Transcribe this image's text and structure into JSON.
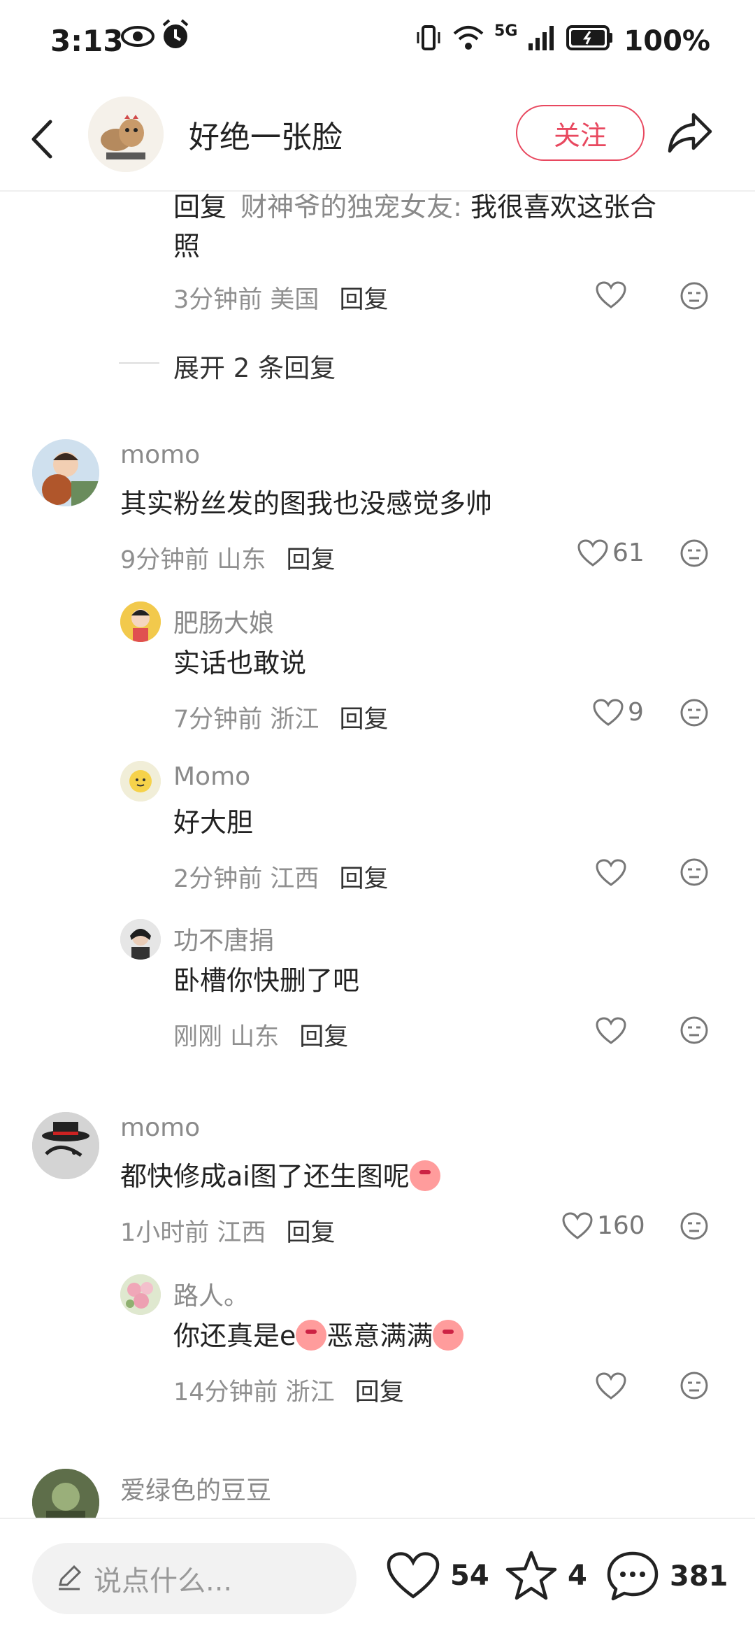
{
  "status_bar": {
    "time": "3:13",
    "network": "5G",
    "battery": "100%"
  },
  "header": {
    "username": "好绝一张脸",
    "follow_label": "关注"
  },
  "thread0": {
    "reply_prefix": "回复",
    "reply_to": "财神爷的独宠女友:",
    "text_line1": "我很喜欢这张合",
    "text_line2": "照",
    "meta": "3分钟前 美国",
    "reply_label": "回复",
    "expand_label": "展开 2 条回复"
  },
  "comment1": {
    "name": "momo",
    "text": "其实粉丝发的图我也没感觉多帅",
    "meta": "9分钟前 山东",
    "reply_label": "回复",
    "likes": "61",
    "replies": [
      {
        "name": "肥肠大娘",
        "text": "实话也敢说",
        "meta": "7分钟前 浙江",
        "reply_label": "回复",
        "likes": "9"
      },
      {
        "name": "Momo",
        "text": "好大胆",
        "meta": "2分钟前 江西",
        "reply_label": "回复",
        "likes": ""
      },
      {
        "name": "功不唐捐",
        "text": "卧槽你快删了吧",
        "meta": "刚刚 山东",
        "reply_label": "回复",
        "likes": ""
      }
    ]
  },
  "comment2": {
    "name": "momo",
    "text": "都快修成ai图了还生图呢",
    "meta": "1小时前 江西",
    "reply_label": "回复",
    "likes": "160",
    "replies": [
      {
        "name": "路人。",
        "text_a": "你还真是e",
        "text_b": "恶意满满",
        "meta": "14分钟前 浙江",
        "reply_label": "回复",
        "likes": ""
      }
    ]
  },
  "comment3": {
    "name": "爱绿色的豆豆"
  },
  "bottom_bar": {
    "input_placeholder": "说点什么...",
    "likes": "54",
    "favorites": "4",
    "comments": "381"
  },
  "colors": {
    "accent": "#e8485f",
    "meta_gray": "#8f8f8f"
  }
}
